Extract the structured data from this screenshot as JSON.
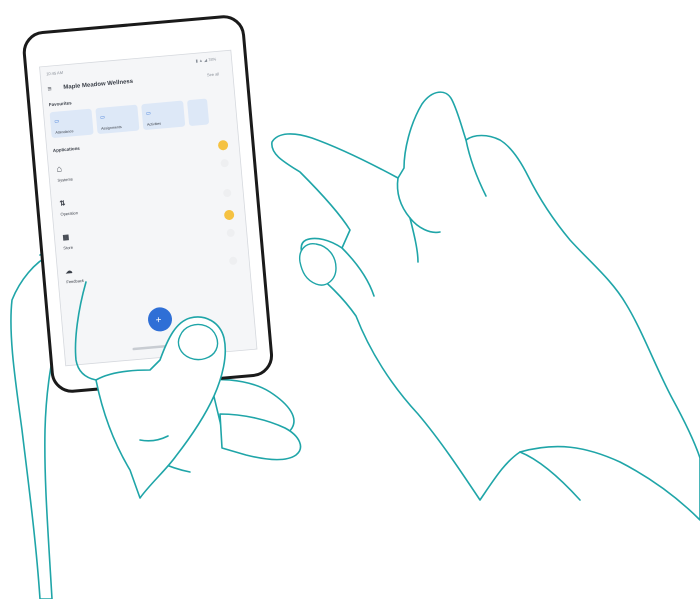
{
  "phone": {
    "status_left": "10:45 AM",
    "status_right": "▮ ▲ ◢ 78%",
    "title": "Maple Meadow Wellness",
    "header_link": "See all",
    "section_favorites": "Favourites",
    "favorites": [
      {
        "label": "Attendance",
        "icon": "calendar-icon"
      },
      {
        "label": "Assignments",
        "icon": "book-icon"
      },
      {
        "label": "Activities",
        "icon": "star-icon"
      }
    ],
    "section_rooms": "Applications",
    "rooms": [
      {
        "label": "Systems",
        "icon": "home-icon",
        "badge": true
      },
      {
        "label": "Operation",
        "icon": "sliders-icon",
        "badge": false
      },
      {
        "label": "Store",
        "icon": "grid-icon",
        "badge": true
      },
      {
        "label": "Feedback",
        "icon": "cloud-icon",
        "badge": false
      }
    ],
    "fab_icon": "plus-icon",
    "accent_color": "#2f6fd6",
    "badge_color": "#f5c242"
  },
  "illustration": {
    "stroke_color": "#1fa5a8"
  }
}
